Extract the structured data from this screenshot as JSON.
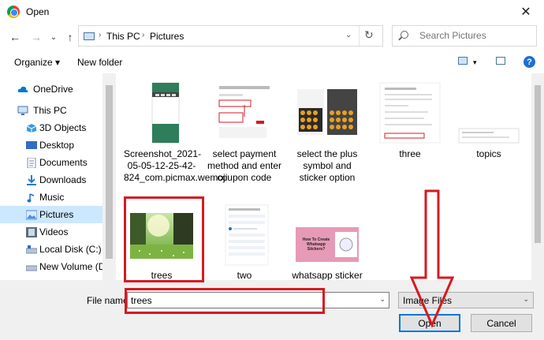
{
  "window": {
    "title": "Open",
    "close_glyph": "✕"
  },
  "nav": {
    "back_glyph": "←",
    "forward_glyph": "→",
    "recent_glyph": "⌄",
    "up_glyph": "↑",
    "breadcrumb": [
      "This PC",
      "Pictures"
    ],
    "separator_glyph": "›",
    "dropdown_glyph": "⌄",
    "refresh_glyph": "↻",
    "search_placeholder": "Search Pictures"
  },
  "toolbar": {
    "organize_label": "Organize ▾",
    "new_folder_label": "New folder",
    "view_menu_glyph": "▾",
    "help_glyph": "?"
  },
  "sidebar": {
    "items": [
      {
        "label": "OneDrive",
        "icon": "cloud-icon",
        "color": "#0078d4"
      },
      {
        "label": "This PC",
        "icon": "computer-icon",
        "color": "#4a74a8"
      },
      {
        "label": "3D Objects",
        "icon": "cube-icon",
        "color": "#3b9ae1"
      },
      {
        "label": "Desktop",
        "icon": "desktop-icon",
        "color": "#2f6ec4"
      },
      {
        "label": "Documents",
        "icon": "document-icon",
        "color": "#7a8da6"
      },
      {
        "label": "Downloads",
        "icon": "download-icon",
        "color": "#2a7ad1"
      },
      {
        "label": "Music",
        "icon": "music-icon",
        "color": "#1f6fd1"
      },
      {
        "label": "Pictures",
        "icon": "pictures-icon",
        "color": "#4a90d9",
        "selected": true
      },
      {
        "label": "Videos",
        "icon": "film-icon",
        "color": "#5a6b82"
      },
      {
        "label": "Local Disk (C:)",
        "icon": "drive-icon",
        "color": "#7b8ea3"
      },
      {
        "label": "New Volume (D:)",
        "icon": "drive-icon",
        "color": "#7b8ea3"
      }
    ]
  },
  "files": [
    {
      "name": "Screenshot_2021-05-05-12-25-42-824_com.picmax.wemoji",
      "icon": "phone-screenshot-thumbnail"
    },
    {
      "name": "select payment method and enter coupon code",
      "icon": "payment-screenshot-thumbnail"
    },
    {
      "name": "select the plus symbol and sticker option",
      "icon": "sticker-screenshot-thumbnail"
    },
    {
      "name": "three",
      "icon": "web-screenshot-thumbnail"
    },
    {
      "name": "topics",
      "icon": "web-screenshot-thumbnail"
    },
    {
      "name": "trees",
      "icon": "trees-photo-thumbnail",
      "selected": true
    },
    {
      "name": "two",
      "icon": "form-screenshot-thumbnail"
    },
    {
      "name": "whatsapp sticker",
      "icon": "whatsapp-sticker-thumbnail"
    }
  ],
  "sticker_text": "How To Create Whatsapp Stickers?",
  "bottom": {
    "file_name_label": "File name:",
    "file_name_value": "trees",
    "file_type_value": "Image Files",
    "dropdown_glyph": "⌄",
    "open_label": "Open",
    "cancel_label": "Cancel"
  },
  "colors": {
    "annotation_red": "#d71920",
    "selection_blue": "#cce8ff",
    "accent": "#0078d7"
  }
}
